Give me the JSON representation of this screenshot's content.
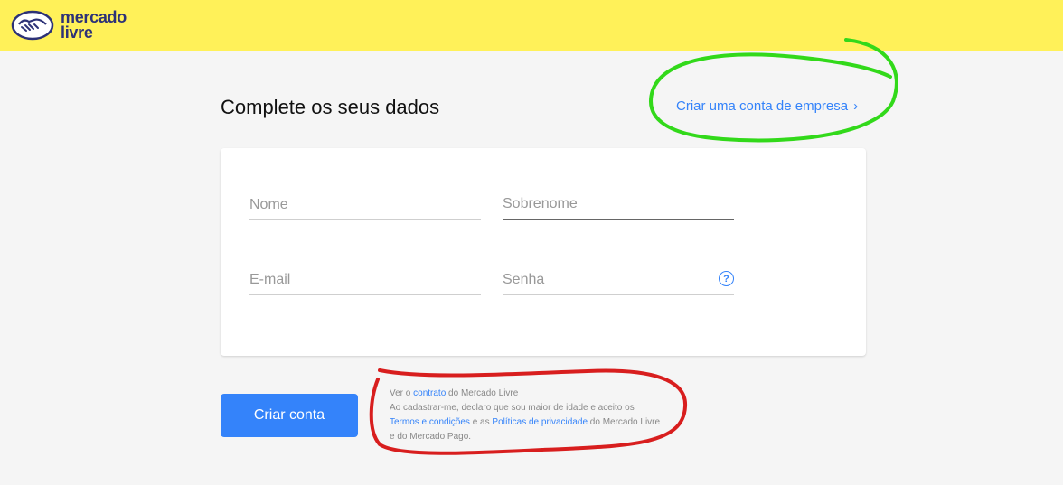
{
  "header": {
    "logo_line1": "mercado",
    "logo_line2": "livre",
    "bg_color": "#fff159"
  },
  "main": {
    "title": "Complete os seus dados",
    "company_link": "Criar uma conta de empresa",
    "company_link_icon": "chevron-right-icon"
  },
  "form": {
    "nome_placeholder": "Nome",
    "sobrenome_placeholder": "Sobrenome",
    "email_placeholder": "E-mail",
    "senha_placeholder": "Senha",
    "help_icon": "?"
  },
  "actions": {
    "submit_label": "Criar conta"
  },
  "terms": {
    "line1_pre": "Ver o ",
    "contract_link": "contrato",
    "line1_post": " do Mercado Livre",
    "line2": "Ao cadastrar-me, declaro que sou maior de idade e aceito os",
    "terms_link": "Termos e condições",
    "and_text": " e as ",
    "privacy_link": "Políticas de privacidade",
    "line3_post": " do Mercado Livre e do Mercado Pago."
  },
  "colors": {
    "accent": "#3483fa",
    "annotation_green": "#32d91a",
    "annotation_red": "#d81e1e"
  }
}
